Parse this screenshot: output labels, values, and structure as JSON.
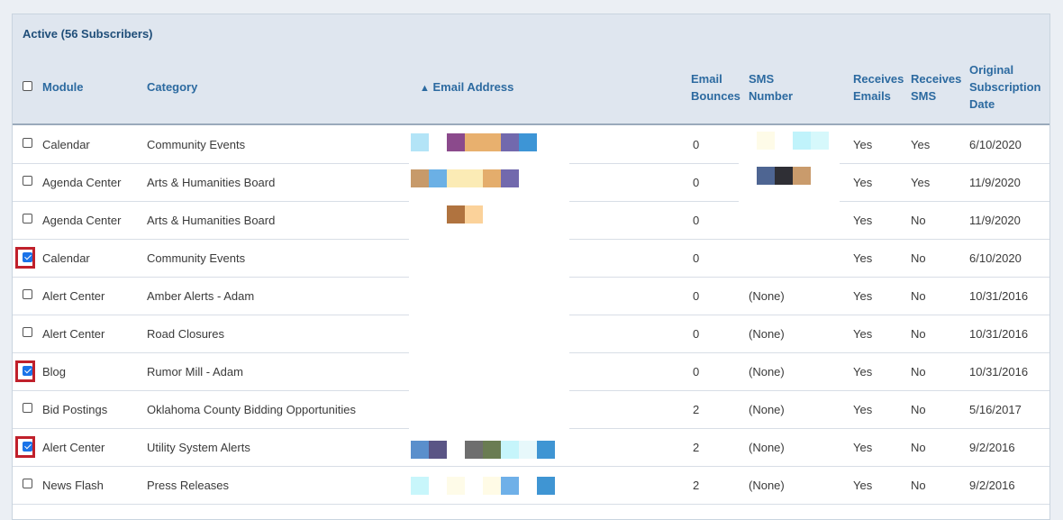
{
  "panel": {
    "title": "Active (56 Subscribers)"
  },
  "columns": {
    "module": "Module",
    "category": "Category",
    "sort_indicator": "▲",
    "email": "Email Address",
    "bounces_1": "Email",
    "bounces_2": "Bounces",
    "sms_1": "SMS",
    "sms_2": "Number",
    "recv_emails_1": "Receives",
    "recv_emails_2": "Emails",
    "recv_sms_1": "Receives",
    "recv_sms_2": "SMS",
    "orig_1": "Original",
    "orig_2": "Subscription",
    "orig_3": "Date"
  },
  "rows": [
    {
      "module": "Calendar",
      "category": "Community Events",
      "bounces": "0",
      "sms": "",
      "recv_emails": "Yes",
      "recv_sms": "Yes",
      "date": "6/10/2020",
      "checked": false
    },
    {
      "module": "Agenda Center",
      "category": "Arts & Humanities Board",
      "bounces": "0",
      "sms": "",
      "recv_emails": "Yes",
      "recv_sms": "Yes",
      "date": "11/9/2020",
      "checked": false
    },
    {
      "module": "Agenda Center",
      "category": "Arts & Humanities Board",
      "bounces": "0",
      "sms": "",
      "recv_emails": "Yes",
      "recv_sms": "No",
      "date": "11/9/2020",
      "checked": false
    },
    {
      "module": "Calendar",
      "category": "Community Events",
      "bounces": "0",
      "sms": "",
      "recv_emails": "Yes",
      "recv_sms": "No",
      "date": "6/10/2020",
      "checked": true
    },
    {
      "module": "Alert Center",
      "category": "Amber Alerts - Adam",
      "bounces": "0",
      "sms": "(None)",
      "recv_emails": "Yes",
      "recv_sms": "No",
      "date": "10/31/2016",
      "checked": false
    },
    {
      "module": "Alert Center",
      "category": "Road Closures",
      "bounces": "0",
      "sms": "(None)",
      "recv_emails": "Yes",
      "recv_sms": "No",
      "date": "10/31/2016",
      "checked": false
    },
    {
      "module": "Blog",
      "category": "Rumor Mill - Adam",
      "bounces": "0",
      "sms": "(None)",
      "recv_emails": "Yes",
      "recv_sms": "No",
      "date": "10/31/2016",
      "checked": true
    },
    {
      "module": "Bid Postings",
      "category": "Oklahoma County Bidding Opportunities",
      "bounces": "2",
      "sms": "(None)",
      "recv_emails": "Yes",
      "recv_sms": "No",
      "date": "5/16/2017",
      "checked": false
    },
    {
      "module": "Alert Center",
      "category": "Utility System Alerts",
      "bounces": "2",
      "sms": "(None)",
      "recv_emails": "Yes",
      "recv_sms": "No",
      "date": "9/2/2016",
      "checked": true
    },
    {
      "module": "News Flash",
      "category": "Press Releases",
      "bounces": "2",
      "sms": "(None)",
      "recv_emails": "Yes",
      "recv_sms": "No",
      "date": "9/2/2016",
      "checked": false
    }
  ],
  "colors": {
    "header_bg": "#dfe6ef",
    "header_text": "#2c6aa0",
    "highlight": "#c0202b",
    "checkbox_checked": "#1a73e8"
  }
}
